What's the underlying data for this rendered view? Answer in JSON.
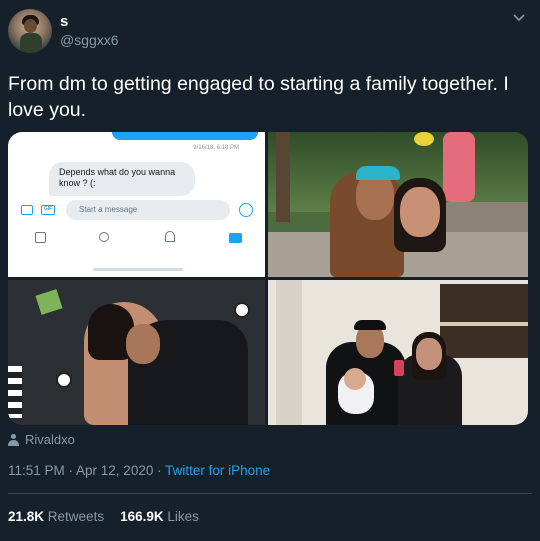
{
  "user": {
    "display_name": "s",
    "username": "@sggxx6"
  },
  "tweet": {
    "text": "From dm to getting engaged to starting a family together. I love you."
  },
  "media": {
    "dm_screenshot": {
      "timestamp": "9/16/18, 6:18 PM",
      "received_message": "Depends what do you wanna know ? (:",
      "input_placeholder": "Start a message",
      "gif_label": "GIF"
    }
  },
  "tagged_user": "Rivaldxo",
  "meta": {
    "time_date": "11:51 PM · Apr 12, 2020 · ",
    "source": "Twitter for iPhone"
  },
  "stats": {
    "retweets_count": "21.8K",
    "retweets_label": "Retweets",
    "likes_count": "166.9K",
    "likes_label": "Likes"
  },
  "colors": {
    "background": "#15202b",
    "secondary_text": "#8899a6",
    "accent": "#1da1f2"
  }
}
